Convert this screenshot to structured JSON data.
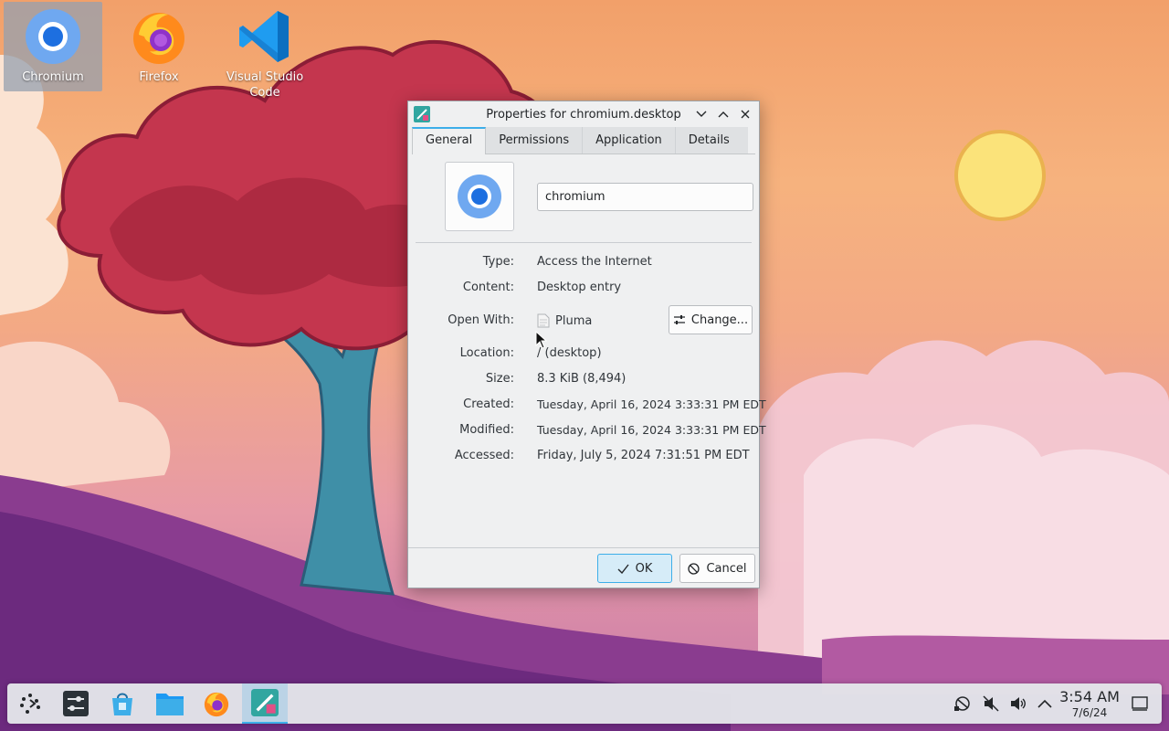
{
  "desktop": {
    "icons": [
      {
        "label": "Chromium",
        "icon": "chromium-icon",
        "selected": true
      },
      {
        "label": "Firefox",
        "icon": "firefox-icon"
      },
      {
        "label": "Visual Studio Code",
        "icon": "vscode-icon"
      }
    ]
  },
  "dialog": {
    "title": "Properties for chromium.desktop",
    "tabs": [
      {
        "label": "General",
        "active": true
      },
      {
        "label": "Permissions"
      },
      {
        "label": "Application"
      },
      {
        "label": "Details"
      }
    ],
    "name_value": "chromium",
    "properties": {
      "type_label": "Type:",
      "type_value": "Access the Internet",
      "content_label": "Content:",
      "content_value": "Desktop entry",
      "open_with_label": "Open With:",
      "open_with_value": "Pluma",
      "change_button": "Change...",
      "location_label": "Location:",
      "location_value": "/ (desktop)",
      "size_label": "Size:",
      "size_value": "8.3 KiB (8,494)",
      "created_label": "Created:",
      "created_value": "Tuesday, April 16, 2024 3:33:31 PM EDT",
      "modified_label": "Modified:",
      "modified_value": "Tuesday, April 16, 2024 3:33:31 PM EDT",
      "accessed_label": "Accessed:",
      "accessed_value": "Friday, July 5, 2024 7:31:51 PM EDT"
    },
    "buttons": {
      "ok": "OK",
      "cancel": "Cancel"
    }
  },
  "panel": {
    "tasks": [
      "application-launcher-icon",
      "system-settings-icon",
      "discover-icon",
      "file-manager-icon",
      "firefox-icon",
      "properties-dialog-icon"
    ],
    "tray": [
      "network-icon",
      "mute-icon",
      "volume-icon",
      "expand-tray-icon"
    ],
    "clock": {
      "time": "3:54 AM",
      "date": "7/6/24"
    }
  },
  "colors": {
    "accent": "#3daee9",
    "dialog_bg": "#eff0f1",
    "panel_bg": "#e4e6ea"
  }
}
